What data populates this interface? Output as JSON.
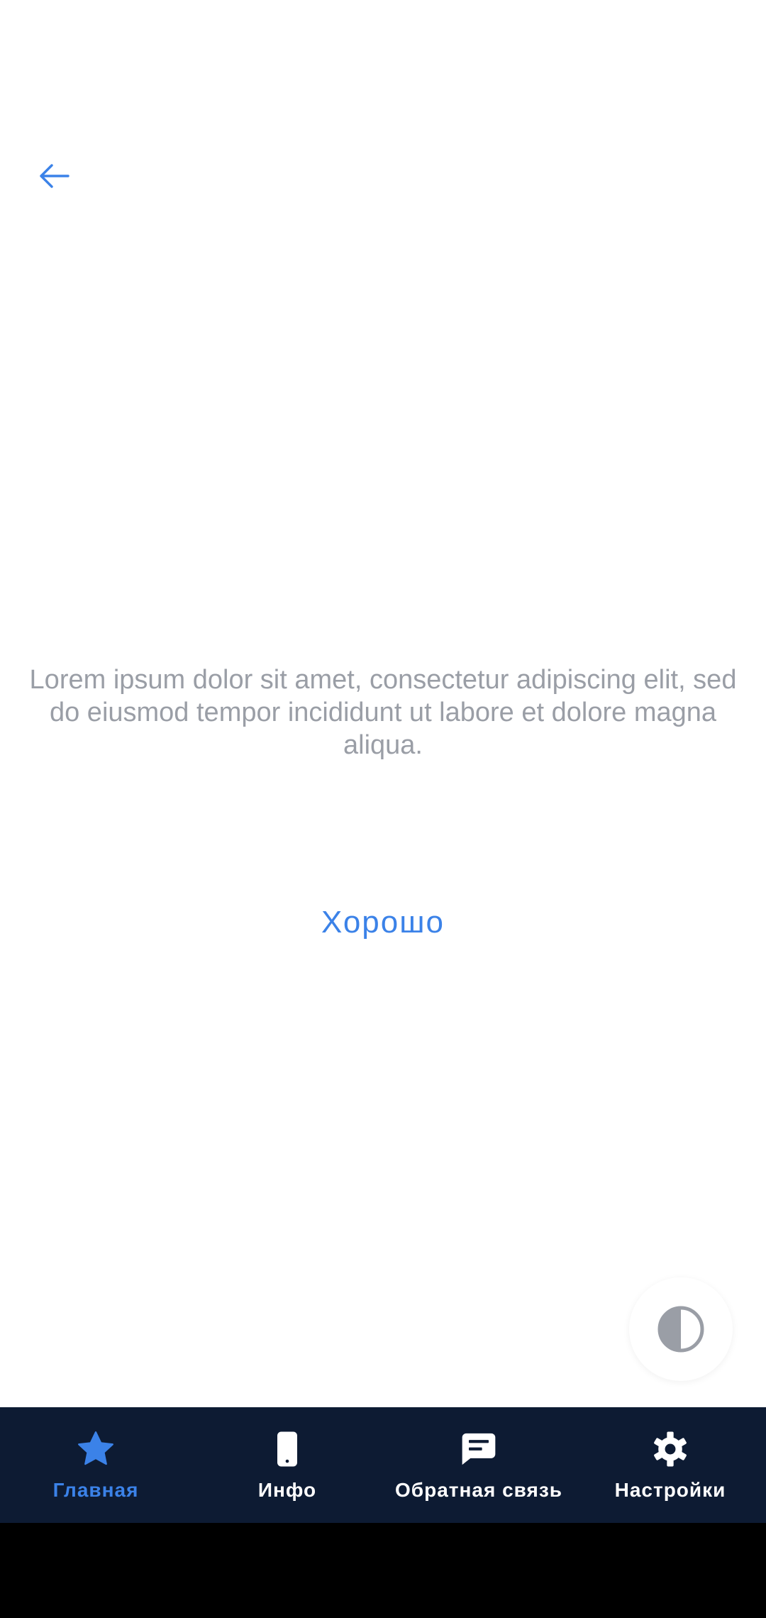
{
  "dialog": {
    "message": "Lorem ipsum dolor sit amet, consectetur adipiscing elit, sed do eiusmod tempor incididunt ut labore et dolore magna aliqua.",
    "ok_label": "Хорошо"
  },
  "bottom_nav": {
    "items": [
      {
        "label": "Главная",
        "icon": "star-icon",
        "active": true
      },
      {
        "label": "Инфо",
        "icon": "phone-icon",
        "active": false
      },
      {
        "label": "Обратная связь",
        "icon": "chat-icon",
        "active": false
      },
      {
        "label": "Настройки",
        "icon": "gear-icon",
        "active": false
      }
    ]
  },
  "colors": {
    "accent": "#3b82e8",
    "nav_background": "#0d1b33",
    "message_text": "#9a9ea6"
  }
}
